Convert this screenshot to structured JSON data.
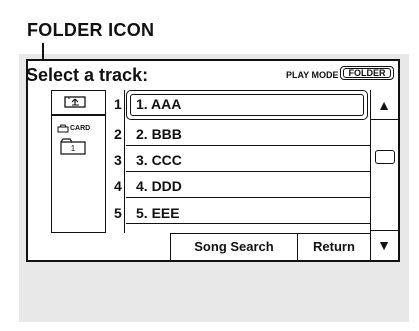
{
  "callout_label": "FOLDER ICON",
  "header": {
    "title": "Select a track:",
    "play_mode_label": "PLAY MODE",
    "play_mode_value": "FOLDER"
  },
  "sidebar": {
    "card_label": "CARD",
    "folder_number": "1"
  },
  "tracks": [
    {
      "number": "1",
      "label": "1. AAA"
    },
    {
      "number": "2",
      "label": "2. BBB"
    },
    {
      "number": "3",
      "label": "3. CCC"
    },
    {
      "number": "4",
      "label": "4. DDD"
    },
    {
      "number": "5",
      "label": "5. EEE"
    }
  ],
  "buttons": {
    "song_search": "Song Search",
    "return": "Return"
  },
  "scroll": {
    "up_glyph": "▲",
    "down_glyph": "▼"
  }
}
